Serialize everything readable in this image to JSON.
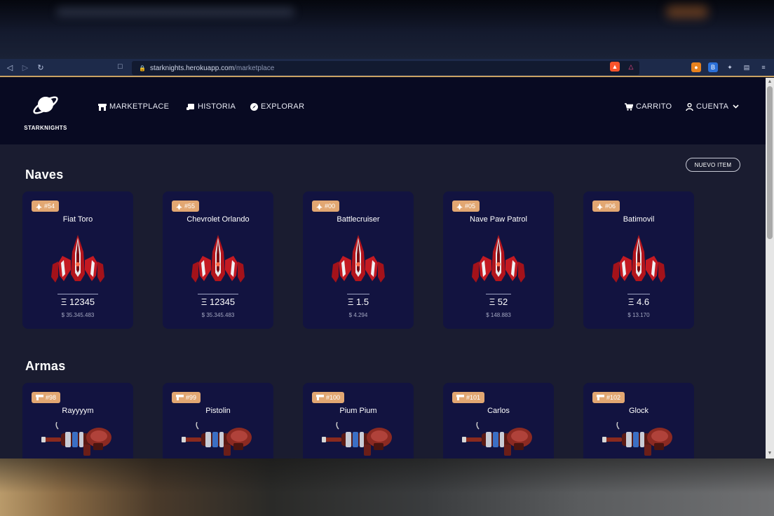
{
  "browser": {
    "url_host": "starknights.herokuapp.com",
    "url_path": "/marketplace"
  },
  "header": {
    "brand": "STARKNIGHTS",
    "nav": {
      "marketplace": "MARKETPLACE",
      "historia": "HISTORIA",
      "explorar": "EXPLORAR",
      "carrito": "CARRITO",
      "cuenta": "CUENTA"
    }
  },
  "actions": {
    "new_item": "NUEVO ITEM"
  },
  "sections": {
    "naves": {
      "title": "Naves",
      "items": [
        {
          "id": "#54",
          "name": "Fiat Toro",
          "eth": "Ξ 12345",
          "usd": "$ 35.345.483"
        },
        {
          "id": "#55",
          "name": "Chevrolet Orlando",
          "eth": "Ξ 12345",
          "usd": "$ 35.345.483"
        },
        {
          "id": "#00",
          "name": "Battlecruiser",
          "eth": "Ξ 1.5",
          "usd": "$ 4.294"
        },
        {
          "id": "#05",
          "name": "Nave Paw Patrol",
          "eth": "Ξ 52",
          "usd": "$ 148.883"
        },
        {
          "id": "#06",
          "name": "Batimovil",
          "eth": "Ξ 4.6",
          "usd": "$ 13.170"
        }
      ]
    },
    "armas": {
      "title": "Armas",
      "items": [
        {
          "id": "#98",
          "name": "Rayyyym"
        },
        {
          "id": "#99",
          "name": "Pistolin"
        },
        {
          "id": "#100",
          "name": "Pium Pium"
        },
        {
          "id": "#101",
          "name": "Carlos"
        },
        {
          "id": "#102",
          "name": "Glock"
        }
      ]
    }
  },
  "colors": {
    "accent": "#e2a772",
    "card": "#121340",
    "header": "#080a22",
    "background": "#1a1c30"
  }
}
